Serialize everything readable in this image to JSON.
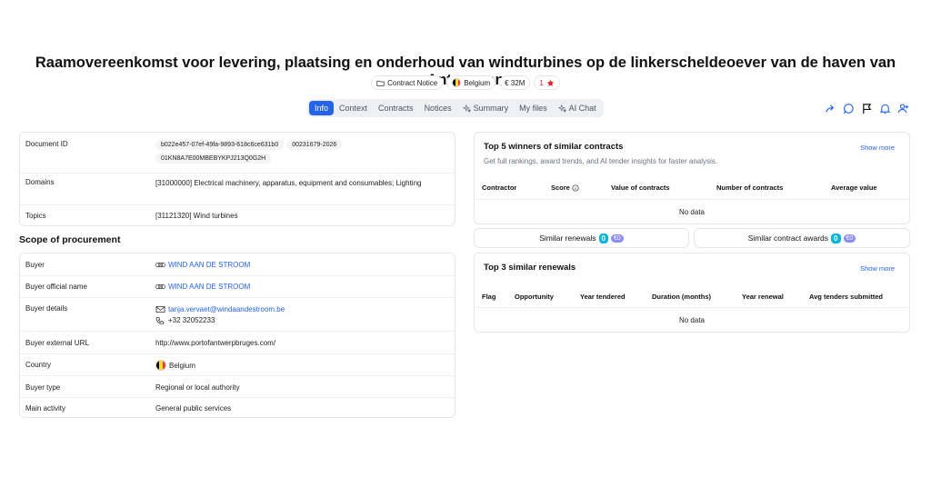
{
  "title": "Raamovereenkomst voor levering, plaatsing en onderhoud van windturbines op de linkerscheldeoever van de haven van Antwerpen",
  "badges": {
    "type": "Contract Notice",
    "country": "Belgium",
    "value": "€ 32M",
    "rating": "1"
  },
  "tabs": [
    "Info",
    "Context",
    "Contracts",
    "Notices",
    "Summary",
    "My files",
    "AI Chat"
  ],
  "info": {
    "doc_id_label": "Document ID",
    "doc_ids": [
      "b022e457-07ef-49fa-9893-618c6ce631b0",
      "00231679-2026",
      "01KN8A7E00MBEBYKPJ213Q0G2H"
    ],
    "domains_label": "Domains",
    "domains_value": "[31000000] Electrical machinery, apparatus, equipment and consumables; Lighting",
    "topics_label": "Topics",
    "topics_value": "[31121320] Wind turbines"
  },
  "scope": {
    "title": "Scope of procurement",
    "buyer_label": "Buyer",
    "buyer_value": "WIND AAN DE STROOM",
    "official_label": "Buyer official name",
    "official_value": "WIND AAN DE STROOM",
    "details_label": "Buyer details",
    "email": "tanja.vervaet@windaandestroom.be",
    "phone": "+32 32052233",
    "url_label": "Buyer external URL",
    "url_value": "http://www.portofantwerpbruges.com/",
    "country_label": "Country",
    "country_value": "Belgium",
    "type_label": "Buyer type",
    "type_value": "Regional or local authority",
    "activity_label": "Main activity",
    "activity_value": "General public services"
  },
  "winners": {
    "title": "Top 5 winners of similar contracts",
    "subtitle": "Get full rankings, award trends, and AI tender insights for faster analysis.",
    "show_more": "Show more",
    "columns": [
      "Contractor",
      "Score",
      "Value of contracts",
      "Number of contracts",
      "Average value"
    ],
    "empty": "No data"
  },
  "similar": {
    "renewals_label": "Similar renewals",
    "renewals_count": "0",
    "renewals_value": "€0",
    "awards_label": "Similar contract awards",
    "awards_count": "0",
    "awards_value": "€0"
  },
  "renewals": {
    "title": "Top 3 similar renewals",
    "show_more": "Show more",
    "columns": [
      "Flag",
      "Opportunity",
      "Year tendered",
      "Duration (months)",
      "Year renewal",
      "Avg tenders submitted"
    ],
    "empty": "No data"
  }
}
